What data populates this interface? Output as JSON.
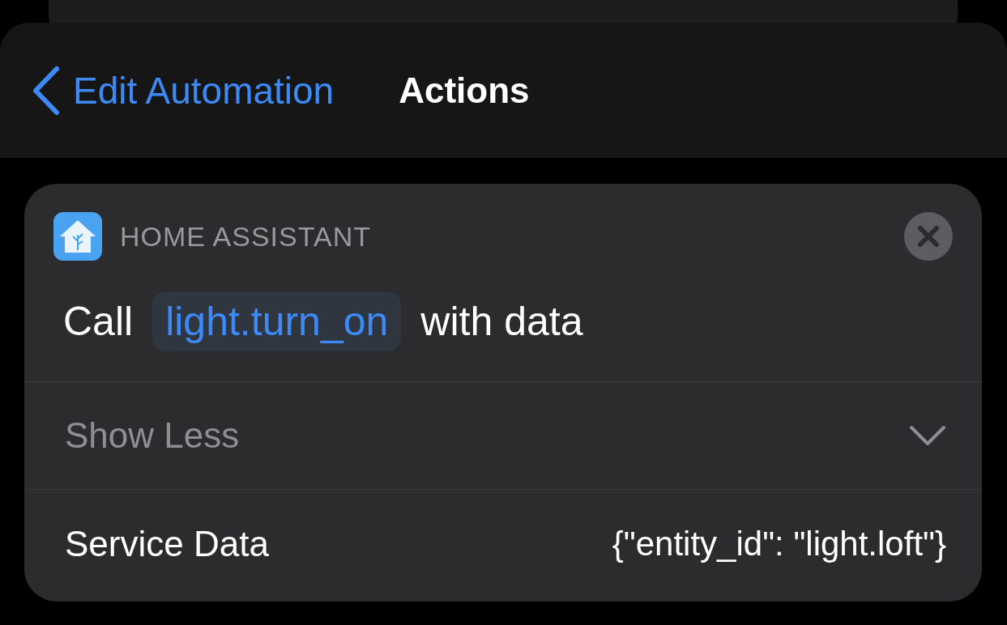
{
  "nav": {
    "back_label": "Edit Automation",
    "title": "Actions"
  },
  "action": {
    "app_name": "HOME ASSISTANT",
    "sentence": [
      {
        "kind": "word",
        "text": "Call"
      },
      {
        "kind": "token",
        "text": "light.turn_on"
      },
      {
        "kind": "word",
        "text": "with data"
      }
    ],
    "toggle": {
      "label": "Show Less",
      "expanded": true
    },
    "fields": [
      {
        "label": "Service Data",
        "value": "{\"entity_id\": \"light.loft\"}"
      }
    ]
  }
}
